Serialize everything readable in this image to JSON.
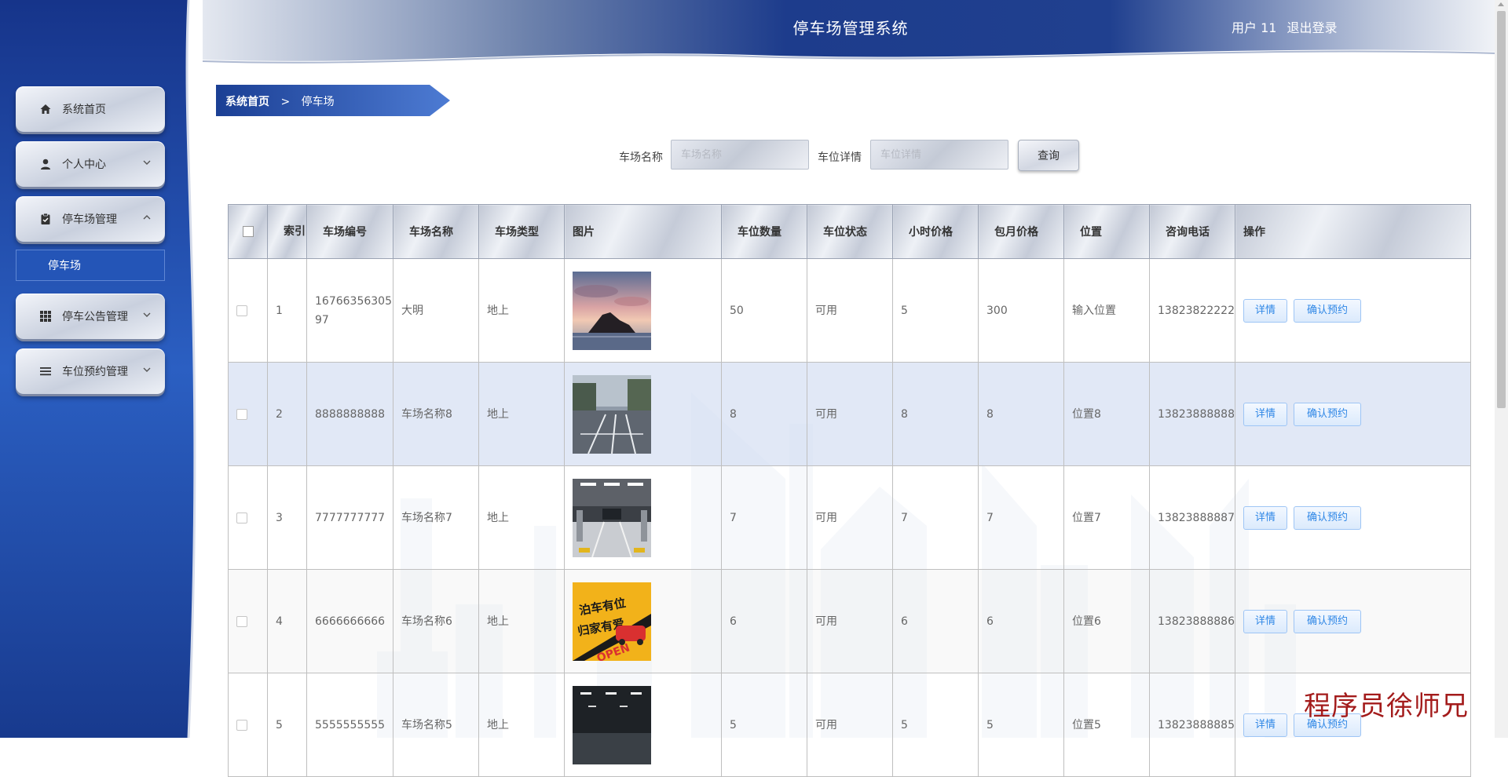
{
  "header": {
    "title": "停车场管理系统",
    "user_label": "用户 11",
    "logout_label": "退出登录"
  },
  "sidebar": {
    "items": [
      {
        "label": "系统首页",
        "icon": "home-icon",
        "expandable": false
      },
      {
        "label": "个人中心",
        "icon": "user-icon",
        "expandable": true,
        "expanded": false
      },
      {
        "label": "停车场管理",
        "icon": "clipboard-check-icon",
        "expandable": true,
        "expanded": true
      },
      {
        "label": "停车公告管理",
        "icon": "grid-icon",
        "expandable": true,
        "expanded": false
      },
      {
        "label": "车位预约管理",
        "icon": "list-icon",
        "expandable": true,
        "expanded": false
      }
    ],
    "submenu": {
      "label": "停车场"
    }
  },
  "breadcrumb": {
    "home": "系统首页",
    "separator": ">",
    "current": "停车场"
  },
  "search": {
    "name_label": "车场名称",
    "name_placeholder": "车场名称",
    "detail_label": "车位详情",
    "detail_placeholder": "车位详情",
    "query_label": "查询"
  },
  "table": {
    "columns": [
      "",
      "索引",
      "车场编号",
      "车场名称",
      "车场类型",
      "图片",
      "车位数量",
      "车位状态",
      "小时价格",
      "包月价格",
      "位置",
      "咨询电话",
      "操作"
    ],
    "rows": [
      {
        "index": "1",
        "code": "1676635630597",
        "name": "大明",
        "type": "地上",
        "image": "sunset-rock-photo",
        "count": "50",
        "status": "可用",
        "hour_price": "5",
        "month_price": "300",
        "location": "输入位置",
        "phone": "13823822222"
      },
      {
        "index": "2",
        "code": "8888888888",
        "name": "车场名称8",
        "type": "地上",
        "image": "street-parking-photo",
        "count": "8",
        "status": "可用",
        "hour_price": "8",
        "month_price": "8",
        "location": "位置8",
        "phone": "13823888888"
      },
      {
        "index": "3",
        "code": "7777777777",
        "name": "车场名称7",
        "type": "地上",
        "image": "garage-interior-photo",
        "count": "7",
        "status": "可用",
        "hour_price": "7",
        "month_price": "7",
        "location": "位置7",
        "phone": "13823888887"
      },
      {
        "index": "4",
        "code": "6666666666",
        "name": "车场名称6",
        "type": "地上",
        "image": "parking-poster-photo",
        "count": "6",
        "status": "可用",
        "hour_price": "6",
        "month_price": "6",
        "location": "位置6",
        "phone": "13823888886"
      },
      {
        "index": "5",
        "code": "5555555555",
        "name": "车场名称5",
        "type": "地上",
        "image": "underground-garage-photo",
        "count": "5",
        "status": "可用",
        "hour_price": "5",
        "month_price": "5",
        "location": "位置5",
        "phone": "13823888885"
      }
    ],
    "actions": {
      "detail": "详情",
      "reserve": "确认预约"
    },
    "poster_text": [
      "泊车有位",
      "归家有爱",
      "OPEN"
    ]
  },
  "watermark": "程序员徐师兄",
  "colors": {
    "sidebar_blue": "#2355b3",
    "header_blue": "#1f3f8f",
    "accent_btn_text": "#2f87e6",
    "row_highlight": "#dce4f5"
  }
}
